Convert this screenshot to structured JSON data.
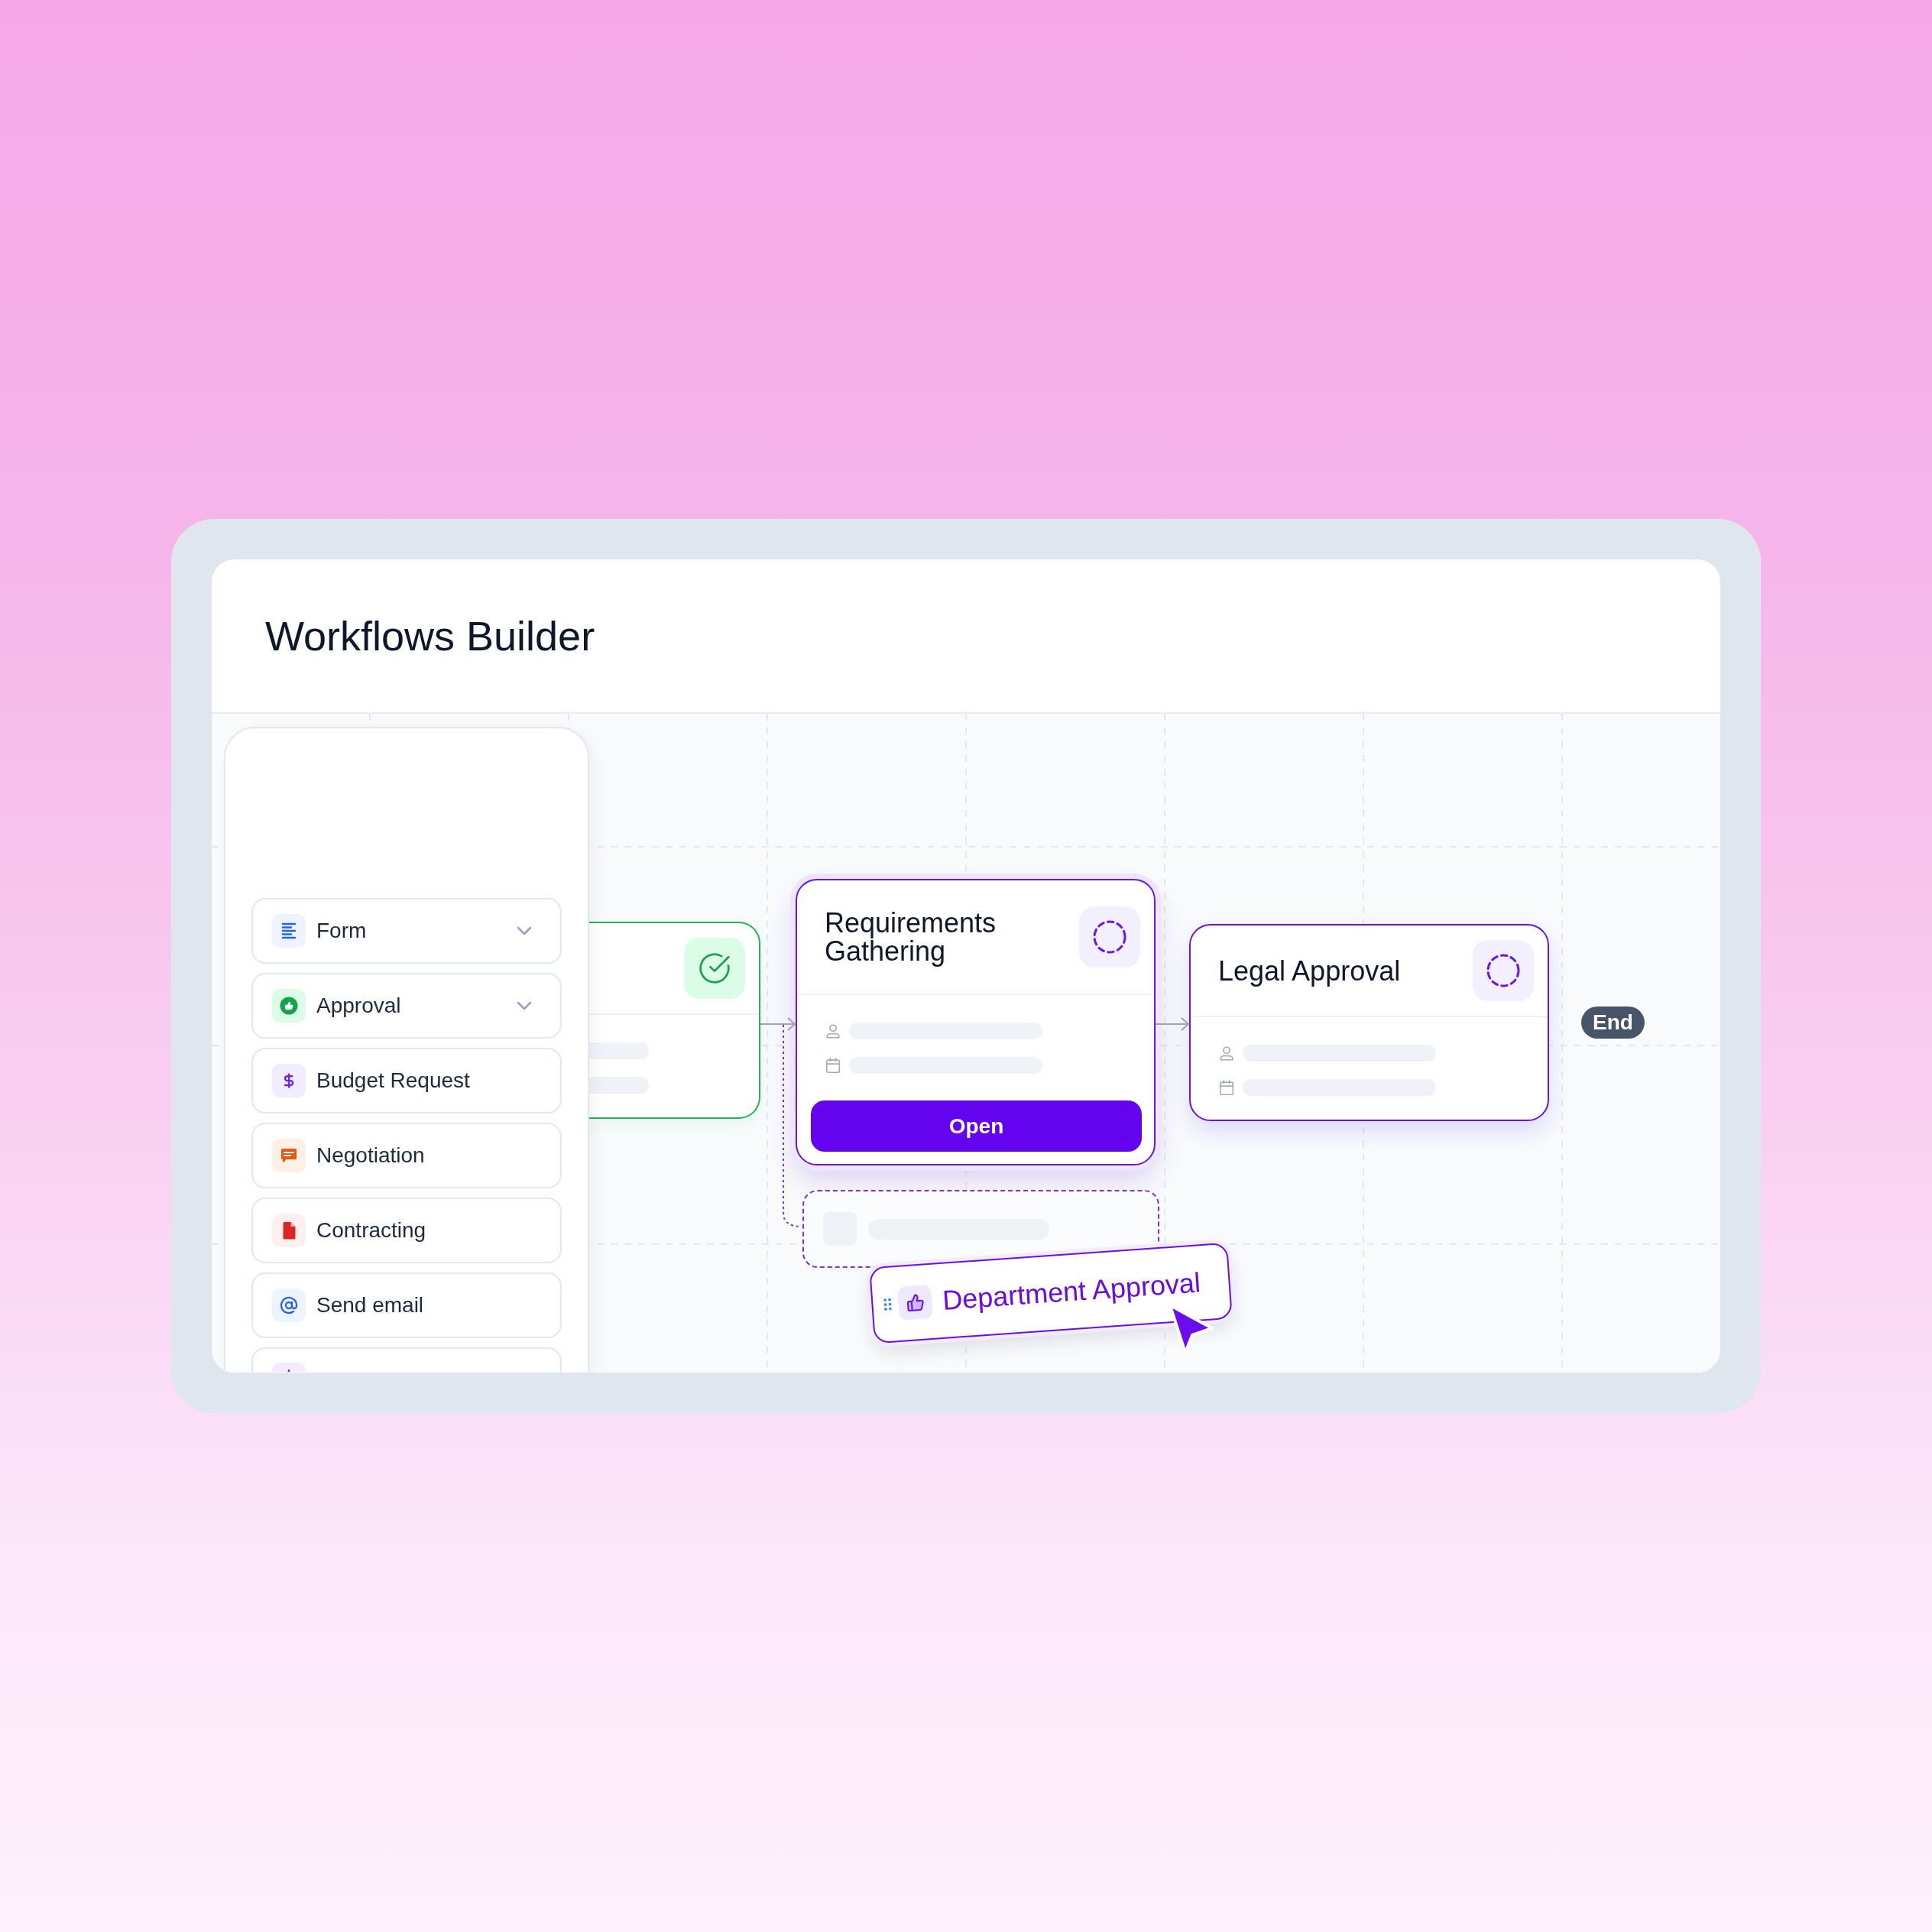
{
  "header": {
    "title": "Workflows Builder"
  },
  "palette": {
    "items": [
      {
        "label": "Form",
        "kind": "form",
        "expandable": true
      },
      {
        "label": "Approval",
        "kind": "approval",
        "expandable": true
      },
      {
        "label": "Budget Request",
        "kind": "budget",
        "expandable": false
      },
      {
        "label": "Negotiation",
        "kind": "negotiation",
        "expandable": false
      },
      {
        "label": "Contracting",
        "kind": "contract",
        "expandable": false
      },
      {
        "label": "Send email",
        "kind": "email",
        "expandable": false
      },
      {
        "kind": "partial",
        "expandable": false
      }
    ]
  },
  "canvas": {
    "nodes": [
      {
        "complete": true,
        "selected": false,
        "clipped": true
      },
      {
        "title": "Requirements Gathering",
        "complete": false,
        "selected": true,
        "clipped": false,
        "button": "Open"
      },
      {
        "title": "Legal Approval",
        "complete": false,
        "selected": false,
        "clipped": false
      }
    ],
    "end": {
      "label": "End"
    },
    "drag": {
      "label": "Department Approval",
      "drop_slot": true
    }
  }
}
